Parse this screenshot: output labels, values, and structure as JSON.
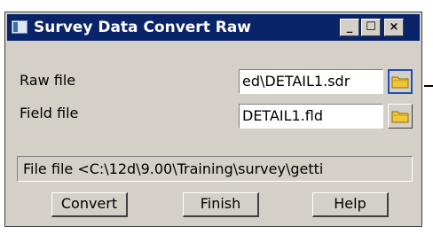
{
  "window": {
    "title": "Survey Data Convert Raw",
    "minimize": "_",
    "maximize": "☐",
    "close": "×"
  },
  "form": {
    "raw_label": "Raw file",
    "raw_value": "ed\\DETAIL1.sdr",
    "field_label": "Field file",
    "field_value": "DETAIL1.fld",
    "status_text": "File file <C:\\12d\\9.00\\Training\\survey\\getti"
  },
  "buttons": {
    "convert": "Convert",
    "finish": "Finish",
    "help": "Help"
  },
  "colors": {
    "titlebar": "#0a246a",
    "dialog": "#d4d0c8",
    "folder": "#f3c53a"
  }
}
